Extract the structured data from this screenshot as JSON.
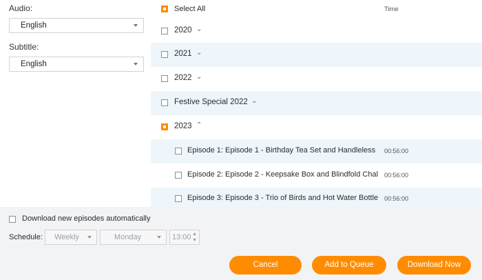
{
  "audio": {
    "label": "Audio:",
    "value": "English"
  },
  "subtitle": {
    "label": "Subtitle:",
    "value": "English"
  },
  "list": {
    "select_all": "Select All",
    "time_header": "Time",
    "groups": [
      {
        "label": "2020",
        "checked": false,
        "expanded": false
      },
      {
        "label": "2021",
        "checked": false,
        "expanded": false
      },
      {
        "label": "2022",
        "checked": false,
        "expanded": false
      },
      {
        "label": "Festive Special 2022",
        "checked": false,
        "expanded": false
      },
      {
        "label": "2023",
        "checked": true,
        "expanded": true
      }
    ],
    "episodes": [
      {
        "title": "Episode 1: Episode 1 - Birthday Tea Set and Handleless",
        "time": "00:56:00"
      },
      {
        "title": "Episode 2: Episode 2 - Keepsake Box and Blindfold Chal",
        "time": "00:56:00"
      },
      {
        "title": "Episode 3: Episode 3 - Trio of Birds and Hot Water Bottle",
        "time": "00:56:00"
      }
    ]
  },
  "auto_download": {
    "label": "Download new episodes automatically"
  },
  "schedule": {
    "label": "Schedule:",
    "frequency": "Weekly",
    "day": "Monday",
    "time": "13:00"
  },
  "buttons": {
    "cancel": "Cancel",
    "add_queue": "Add to Queue",
    "download": "Download Now"
  },
  "colors": {
    "accent": "#ff8c00",
    "row_alt": "#eef6fb",
    "background": "#f2f3f5"
  }
}
